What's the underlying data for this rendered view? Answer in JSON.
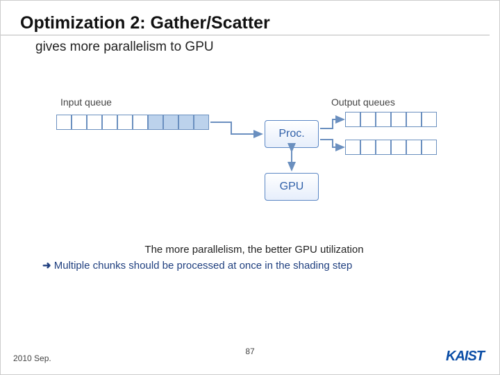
{
  "title": "Optimization 2: Gather/Scatter",
  "subtitle": "gives more parallelism to GPU",
  "diagram": {
    "input_label": "Input queue",
    "output_label": "Output queues",
    "proc_label": "Proc.",
    "gpu_label": "GPU"
  },
  "caption": {
    "line1": "The more parallelism, the better GPU utilization",
    "arrow": "➜",
    "line2": "Multiple chunks should be processed at once in the shading step"
  },
  "footer": {
    "date": "2010 Sep.",
    "page": "87",
    "logo": "KAIST"
  }
}
